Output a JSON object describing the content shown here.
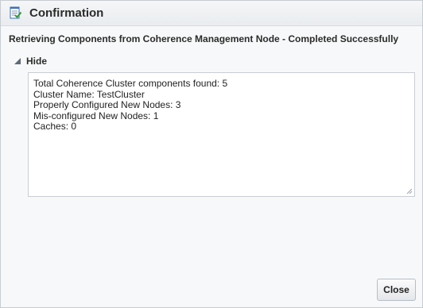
{
  "dialog": {
    "title": "Confirmation",
    "title_icon": "checklist-icon",
    "message": "Retrieving Components from Coherence Management Node - Completed Successfully",
    "toggle": {
      "label": "Hide",
      "icon": "triangle-expanded-icon"
    },
    "details_lines": [
      "Total Coherence Cluster components found: 5",
      "Cluster Name: TestCluster",
      "Properly Configured New Nodes: 3",
      "Mis-configured New Nodes: 1",
      "Caches: 0"
    ],
    "close_label": "Close"
  },
  "colors": {
    "title_background": "#eceff2",
    "border": "#c7ccd1",
    "icon_blue": "#3d6fb6",
    "icon_green": "#2f9a3a"
  }
}
